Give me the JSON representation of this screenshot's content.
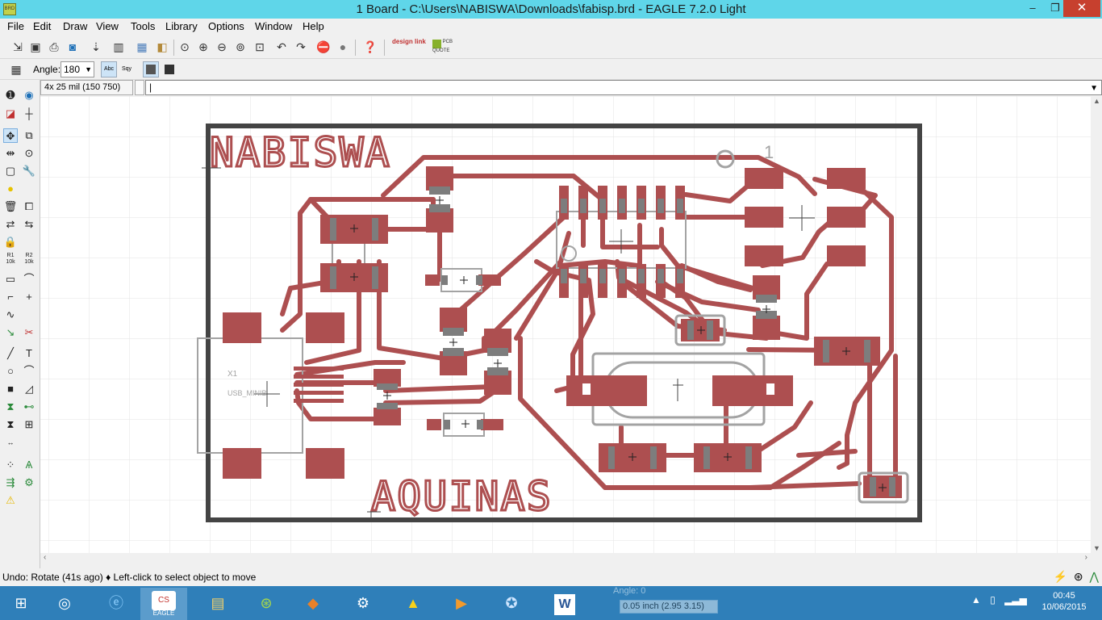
{
  "window": {
    "title": "1 Board - C:\\Users\\NABISWA\\Downloads\\fabisp.brd - EAGLE 7.2.0 Light",
    "icon_label": "BRD",
    "minimize": "–",
    "maximize": "❐",
    "close": "✕"
  },
  "menu": [
    "File",
    "Edit",
    "Draw",
    "View",
    "Tools",
    "Library",
    "Options",
    "Window",
    "Help"
  ],
  "toolbar": {
    "designlink": "design link",
    "pcbquote": "PCB QUOTE"
  },
  "params": {
    "angle_label": "Angle:",
    "angle_value": "180",
    "abc_label": "Abc",
    "sqy_label": "Sqy"
  },
  "command": {
    "coord": "4x 25 mil (150 750)",
    "value": "|"
  },
  "board": {
    "top_text": "NABISWA",
    "bottom_text": "AQUINAS",
    "pin_one": "1",
    "connector_name": "X1",
    "connector_value": "USB_MINIB"
  },
  "status": {
    "text": "Undo: Rotate (41s ago) ♦ Left-click to select object to move"
  },
  "taskbar": {
    "ghost_angle": "Angle: 0",
    "ghost_coord": "0.05 inch (2.95 3.15)",
    "eagle_label": "EAGLE",
    "time": "00:45",
    "date": "10/06/2015"
  },
  "colors": {
    "titlebar": "#5fd6e9",
    "copper": "#ad4f50",
    "pad_stub": "#7d7d7d",
    "outline": "#444444",
    "silkscreen": "#a3a3a3",
    "taskbar": "#2f7fb9"
  }
}
